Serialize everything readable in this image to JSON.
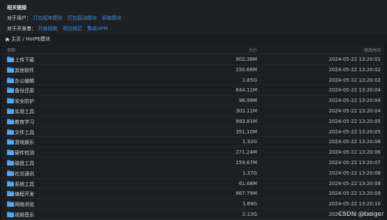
{
  "panel": {
    "title": "相关链接",
    "users_prefix": "对于用户：",
    "users_links": [
      "打包程序模块",
      "打包驱动模块",
      "拆箱模块"
    ],
    "devs_prefix": "对于开发者：",
    "devs_links": [
      "开发指南",
      "项目规范",
      "集成HPM"
    ]
  },
  "breadcrumb": {
    "text": "主页 / HotPE模块"
  },
  "table": {
    "headers": {
      "name": "名称",
      "size": "大小",
      "date": "修改时间"
    },
    "rows": [
      {
        "name": "上传下载",
        "size": "902.38M",
        "date": "2024-05-22 13:20:01"
      },
      {
        "name": "其他软件",
        "size": "150.66M",
        "date": "2024-05-22 13:20:02"
      },
      {
        "name": "办公编辑",
        "size": "1.65G",
        "date": "2024-05-22 13:20:02"
      },
      {
        "name": "备份还原",
        "size": "644.11M",
        "date": "2024-05-22 13:20:04"
      },
      {
        "name": "安全防护",
        "size": "96.99M",
        "date": "2024-05-22 13:20:04"
      },
      {
        "name": "实用工具",
        "size": "303.11M",
        "date": "2024-05-22 13:20:04"
      },
      {
        "name": "教育学习",
        "size": "993.81M",
        "date": "2024-05-22 13:20:05"
      },
      {
        "name": "文件工具",
        "size": "351.10M",
        "date": "2024-05-22 13:20:05"
      },
      {
        "name": "游戏娱乐",
        "size": "1.32G",
        "date": "2024-05-22 13:20:06"
      },
      {
        "name": "硬件检测",
        "size": "271.24M",
        "date": "2024-05-22 13:20:06"
      },
      {
        "name": "磁盘工具",
        "size": "159.67M",
        "date": "2024-05-22 13:20:07"
      },
      {
        "name": "社交通讯",
        "size": "1.37G",
        "date": "2024-05-22 13:20:08"
      },
      {
        "name": "系统工具",
        "size": "61.68M",
        "date": "2024-05-22 13:20:08"
      },
      {
        "name": "编程开发",
        "size": "867.79M",
        "date": "2024-05-22 13:20:08"
      },
      {
        "name": "网络浏览",
        "size": "1.69G",
        "date": "2024-05-22 13:20:10"
      },
      {
        "name": "视频音乐",
        "size": "2.13G",
        "date": "2024-05-22 13:20:10"
      }
    ]
  },
  "watermark": "CSDN @beiger",
  "colors": {
    "link": "#3b8ee5",
    "folder": "#2f8fe6",
    "background": "#16181b"
  },
  "icons": {
    "breadcrumb": "home-icon",
    "row": "folder-icon"
  }
}
